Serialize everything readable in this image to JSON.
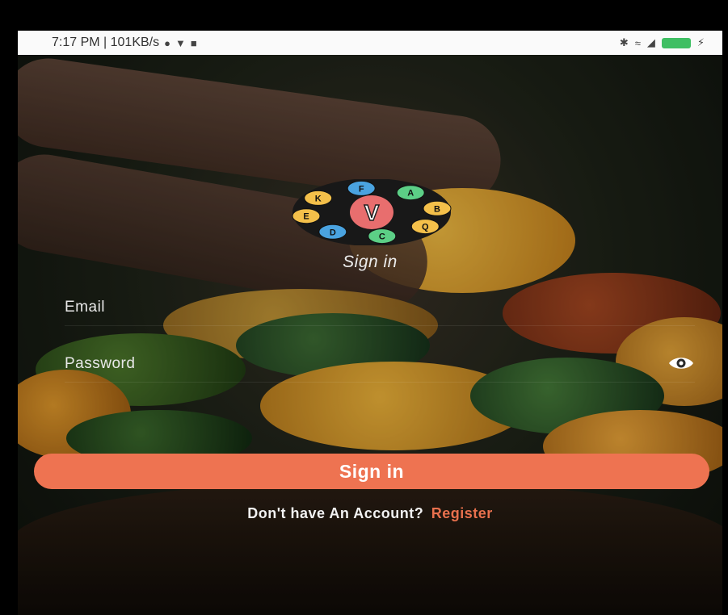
{
  "status_bar": {
    "time_speed": "7:17 PM | 101KB/s",
    "left_icons": [
      "chat-icon",
      "shield-icon",
      "notification-icon"
    ],
    "right_icons": [
      "bluetooth-icon",
      "wifi-icon",
      "signal-icon",
      "battery-icon",
      "charging-icon"
    ]
  },
  "logo": {
    "center_letter": "V",
    "ring_letters": [
      "F",
      "A",
      "B",
      "Q",
      "C",
      "D",
      "E",
      "K"
    ]
  },
  "title": "Sign in",
  "form": {
    "email_placeholder": "Email",
    "email_value": "",
    "password_placeholder": "Password",
    "password_value": ""
  },
  "signin_button_label": "Sign in",
  "register": {
    "prompt": "Don't have An Account?",
    "link_label": "Register"
  },
  "colors": {
    "accent": "#ee7351",
    "register_link": "#e8704d"
  }
}
